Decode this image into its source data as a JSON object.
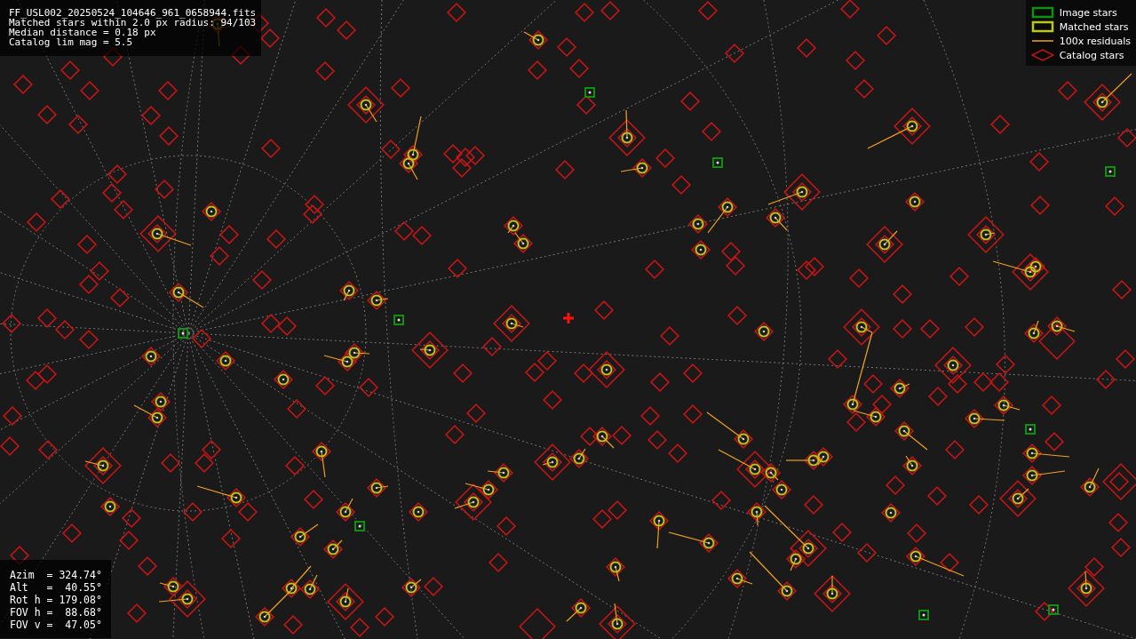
{
  "header_info": {
    "lines": [
      "FF_USL002_20250524_104646_961_0658944.fits",
      "Matched stars within 2.0 px radius: 94/103",
      "Median distance = 0.18 px",
      "Catalog lim mag = 5.5"
    ]
  },
  "legend": {
    "items": [
      {
        "kind": "image",
        "label": "Image stars"
      },
      {
        "kind": "matched",
        "label": "Matched stars"
      },
      {
        "kind": "residual",
        "label": "100x residuals"
      },
      {
        "kind": "catalog",
        "label": "Catalog stars"
      }
    ]
  },
  "pointing": {
    "lines": [
      "Azim  = 324.74°",
      "Alt   =  40.55°",
      "Rot h = 179.08°",
      "FOV h =  88.68°",
      "FOV v =  47.05°"
    ]
  }
}
